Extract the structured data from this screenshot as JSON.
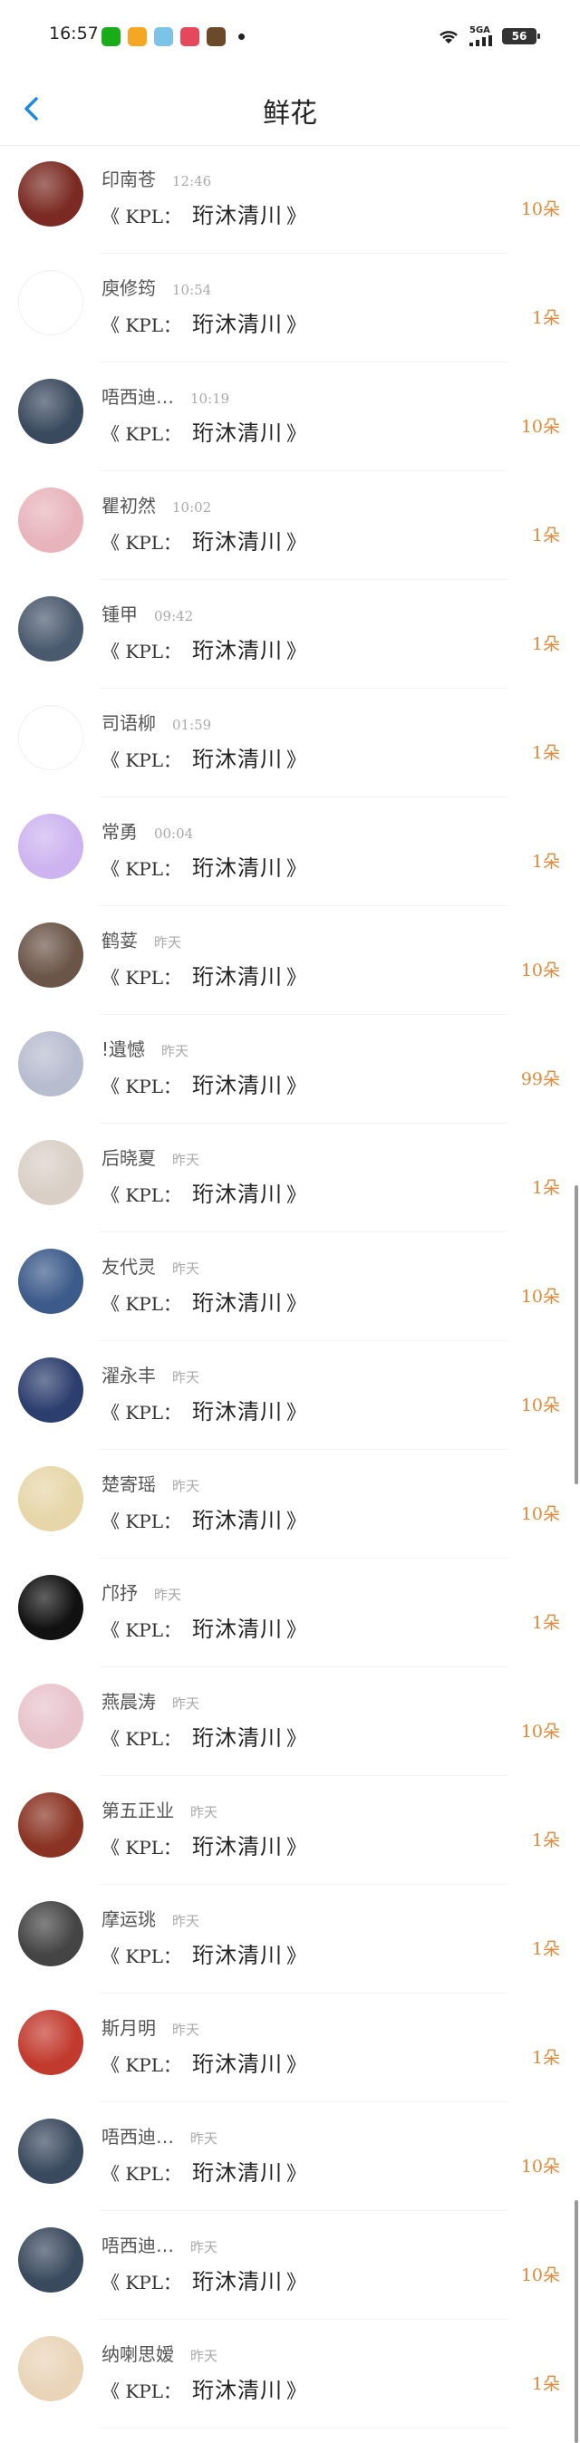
{
  "status_bar": {
    "time": "16:57",
    "battery": "56",
    "signal": "5GA",
    "app_icons": [
      {
        "name": "wechat-icon",
        "color": "#1aad19"
      },
      {
        "name": "weibo-icon",
        "color": "#f5a623"
      },
      {
        "name": "photos-icon",
        "color": "#7bc4e8"
      },
      {
        "name": "video-icon",
        "color": "#e5475b"
      },
      {
        "name": "game-icon",
        "color": "#6b4a2a"
      }
    ]
  },
  "nav": {
    "title": "鲜花",
    "back_icon": "chevron-left-icon",
    "accent": "#1e88e5"
  },
  "gift_text": {
    "kpl": "《 KPL：",
    "hero": "珩沐清川",
    "close": "》"
  },
  "items": [
    {
      "name": "印南苍",
      "time": "12:46",
      "count": "10朵",
      "avatar_color": "#7a2a22"
    },
    {
      "name": "庾修筠",
      "time": "10:54",
      "count": "1朵",
      "avatar_color": "#ffffff"
    },
    {
      "name": "唔西迪…",
      "time": "10:19",
      "count": "10朵",
      "avatar_color": "#3a4a5e"
    },
    {
      "name": "瞿初然",
      "time": "10:02",
      "count": "1朵",
      "avatar_color": "#e8b4bc"
    },
    {
      "name": "锺甲",
      "time": "09:42",
      "count": "1朵",
      "avatar_color": "#4a5a6e"
    },
    {
      "name": "司语柳",
      "time": "01:59",
      "count": "1朵",
      "avatar_color": "#ffffff"
    },
    {
      "name": "常勇",
      "time": "00:04",
      "count": "1朵",
      "avatar_color": "#cdb4f0"
    },
    {
      "name": "鹤荽",
      "time": "昨天",
      "count": "10朵",
      "avatar_color": "#6b5548"
    },
    {
      "name": "!遺憾",
      "time": "昨天",
      "count": "99朵",
      "avatar_color": "#b8bccf"
    },
    {
      "name": "后晓夏",
      "time": "昨天",
      "count": "1朵",
      "avatar_color": "#d9cfc6"
    },
    {
      "name": "友代灵",
      "time": "昨天",
      "count": "10朵",
      "avatar_color": "#3c5a8a"
    },
    {
      "name": "濯永丰",
      "time": "昨天",
      "count": "10朵",
      "avatar_color": "#2c3e6e"
    },
    {
      "name": "楚寄瑶",
      "time": "昨天",
      "count": "10朵",
      "avatar_color": "#e6d6a8"
    },
    {
      "name": "邝抒",
      "time": "昨天",
      "count": "1朵",
      "avatar_color": "#111111"
    },
    {
      "name": "燕晨涛",
      "time": "昨天",
      "count": "10朵",
      "avatar_color": "#e8c3cc"
    },
    {
      "name": "第五正业",
      "time": "昨天",
      "count": "1朵",
      "avatar_color": "#8a3322"
    },
    {
      "name": "摩运珧",
      "time": "昨天",
      "count": "1朵",
      "avatar_color": "#444444"
    },
    {
      "name": "斯月明",
      "time": "昨天",
      "count": "1朵",
      "avatar_color": "#c23a2e"
    },
    {
      "name": "唔西迪…",
      "time": "昨天",
      "count": "10朵",
      "avatar_color": "#3a4a5e"
    },
    {
      "name": "唔西迪…",
      "time": "昨天",
      "count": "10朵",
      "avatar_color": "#3a4a5e"
    },
    {
      "name": "纳喇思嫒",
      "time": "昨天",
      "count": "1朵",
      "avatar_color": "#e9d4b8"
    }
  ]
}
